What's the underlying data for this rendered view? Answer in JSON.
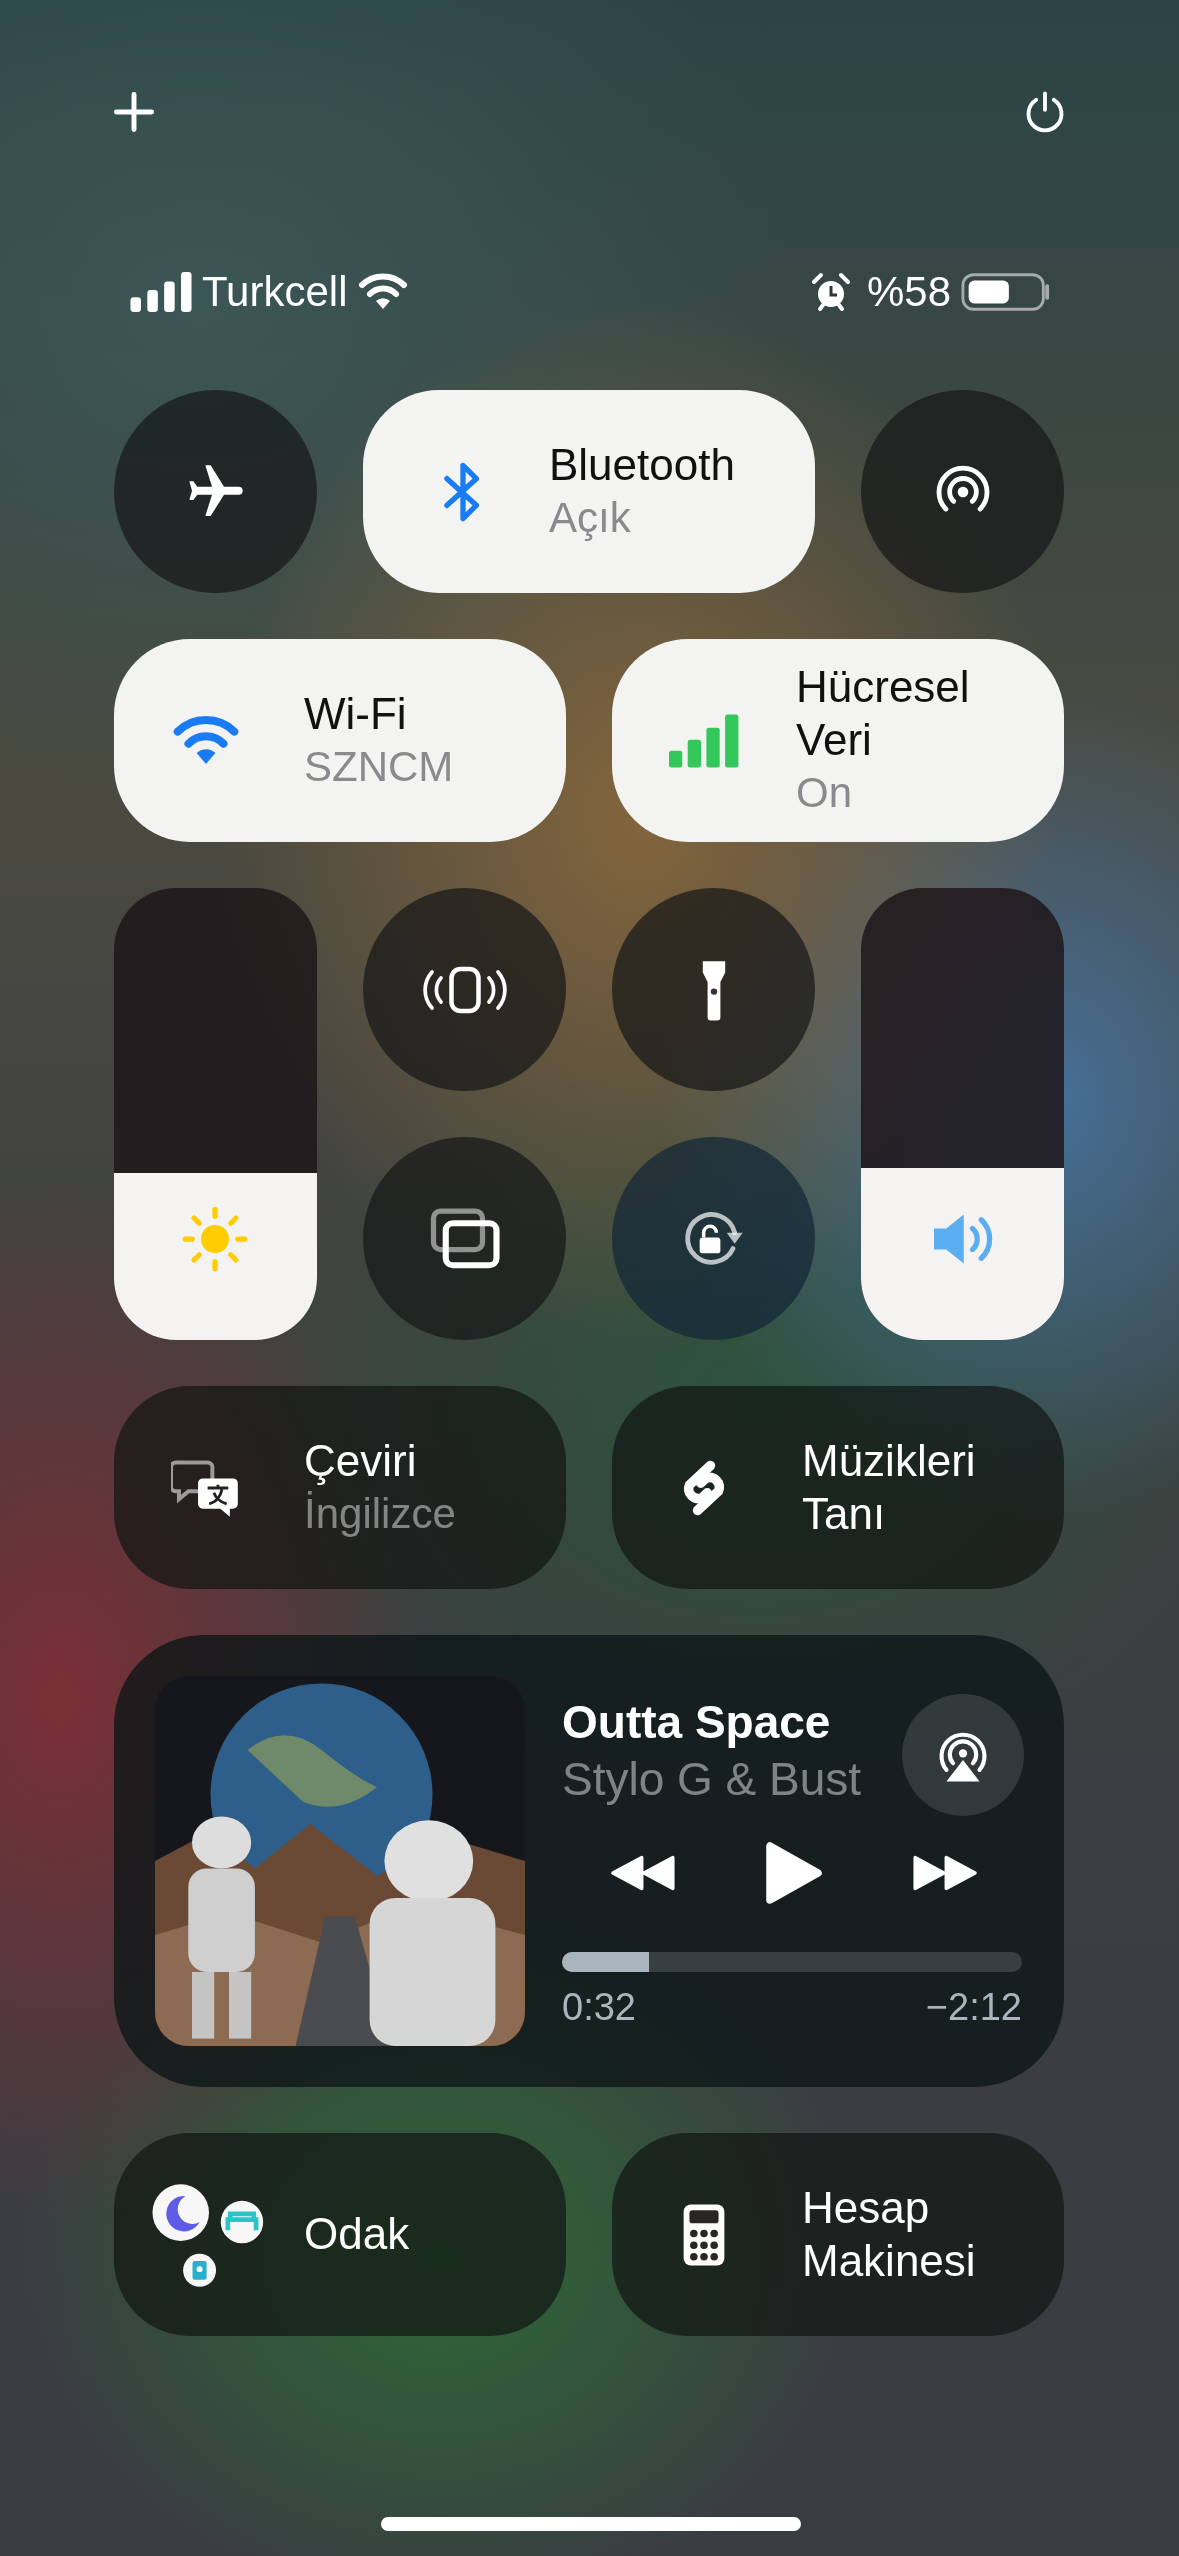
{
  "status_bar": {
    "carrier": "Turkcell",
    "battery": "%58"
  },
  "connectivity": [
    {
      "kind": "airplane",
      "on": false
    },
    {
      "kind": "bluetooth",
      "label": "Bluetooth",
      "status": "Açık",
      "on": true
    },
    {
      "kind": "airdrop",
      "on": false
    },
    {
      "kind": "wifi",
      "label": "Wi-Fi",
      "status": "SZNCM",
      "on": true
    },
    {
      "kind": "cellular",
      "label": "Hücresel Veri",
      "status": "On",
      "on": true
    }
  ],
  "sliders": [
    {
      "kind": "brightness",
      "level": 0.37
    },
    {
      "kind": "volume",
      "level": 0.38
    }
  ],
  "shortcuts": [
    {
      "kind": "translate",
      "title": "Çeviri",
      "subtitle": "İngilizce"
    },
    {
      "kind": "music_recognition",
      "title": "Müzikleri Tanı"
    }
  ],
  "now_playing": {
    "title": "Outta Space",
    "artist": "Stylo G & Bust",
    "level": 0.19,
    "elapsed": "0:32",
    "remaining": "−2:12"
  },
  "bottom": [
    {
      "kind": "focus",
      "title": "Odak"
    },
    {
      "kind": "calculator",
      "title": "Hesap Makinesi"
    }
  ]
}
